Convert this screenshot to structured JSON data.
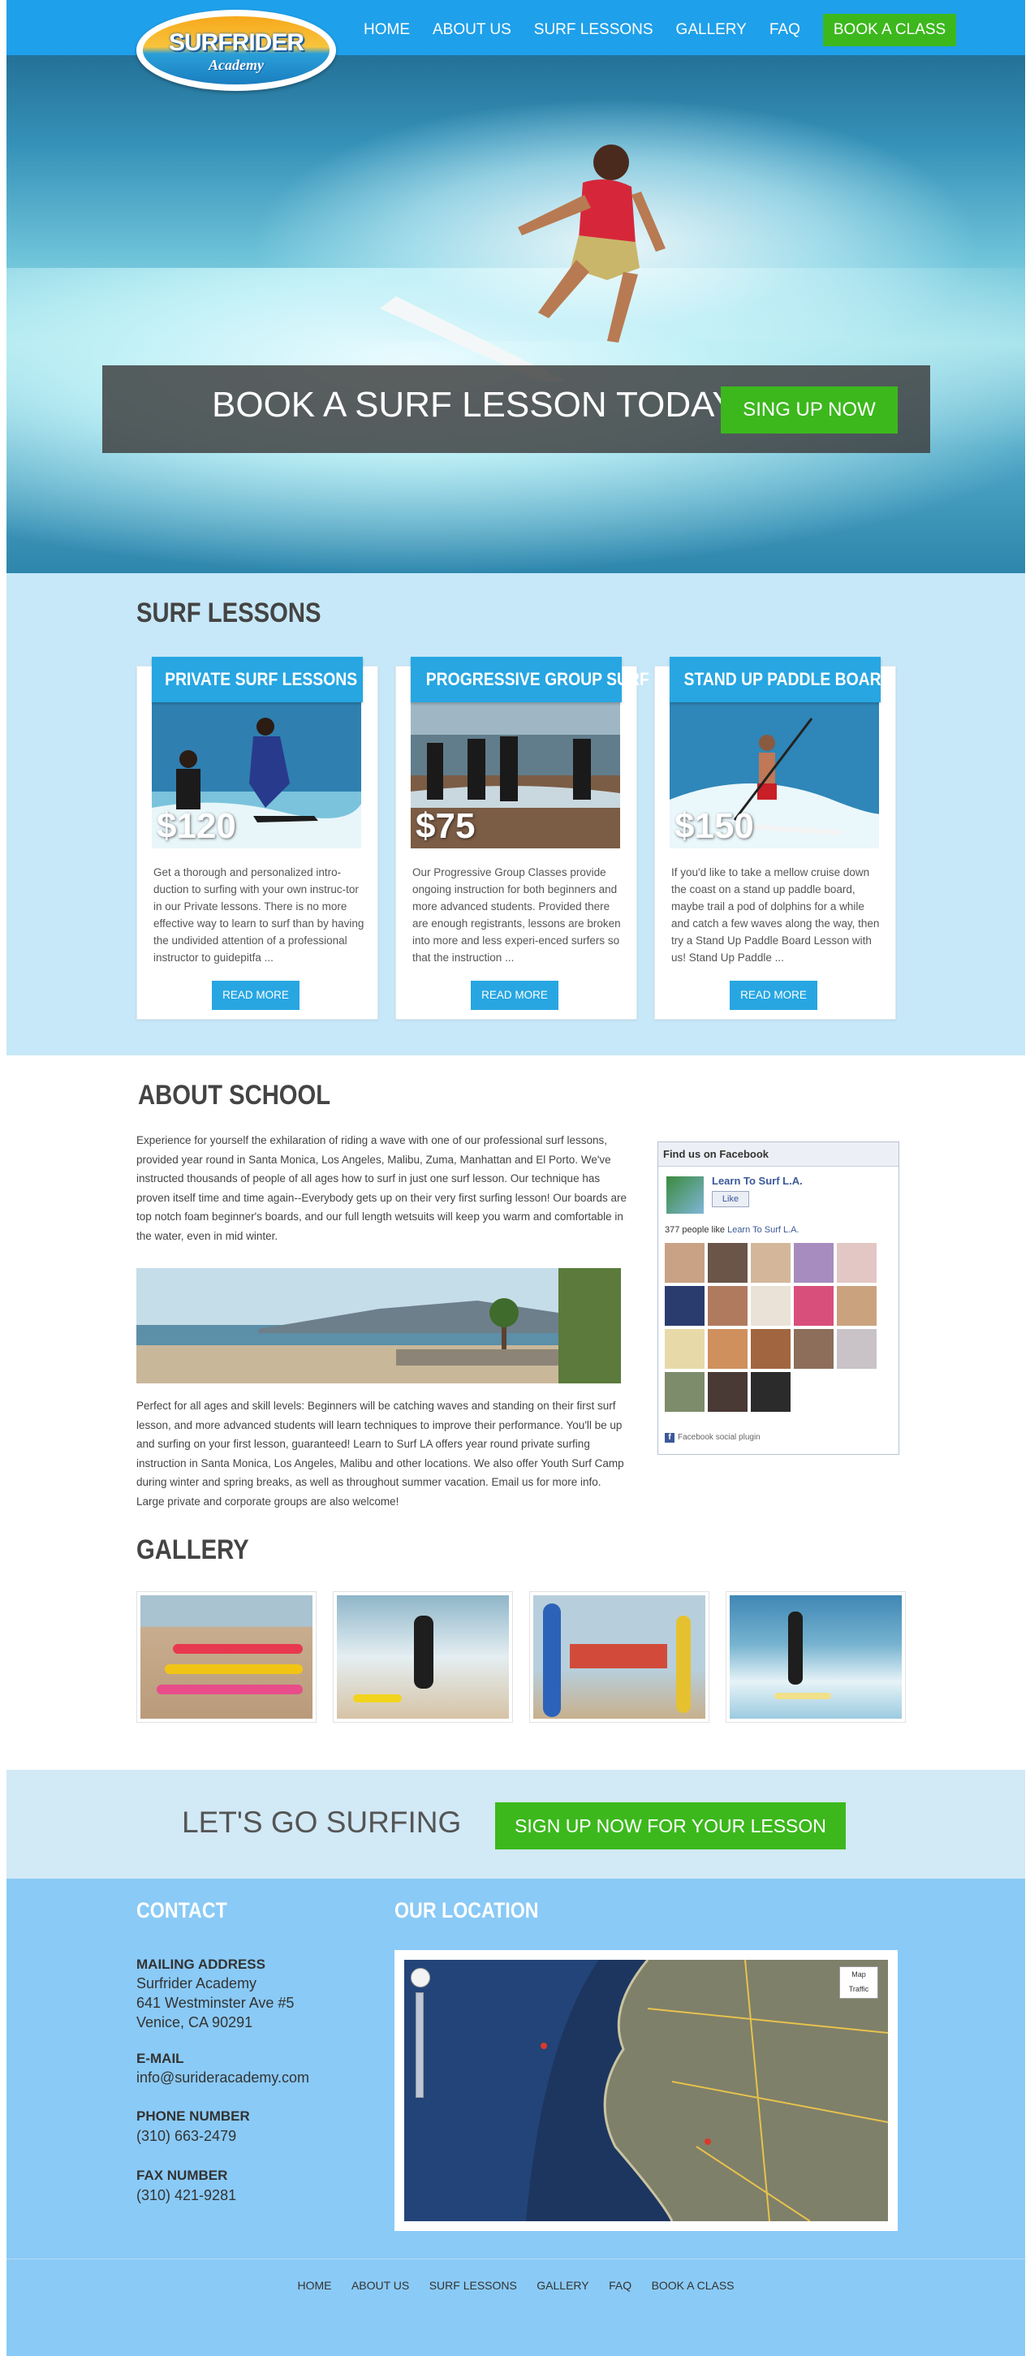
{
  "nav": {
    "logo_title": "SURFRIDER",
    "logo_subtitle": "Academy",
    "items": [
      "HOME",
      "ABOUT US",
      "SURF LESSONS",
      "GALLERY",
      "FAQ"
    ],
    "cta": "BOOK A CLASS"
  },
  "hero": {
    "headline": "BOOK A SURF LESSON TODAY",
    "button": "SING UP NOW"
  },
  "lessons": {
    "heading": "SURF LESSONS",
    "cards": [
      {
        "title": "PRIVATE SURF LESSONS",
        "price": "$120",
        "description": "Get a thorough and personalized intro-duction to surfing with your own instruc-tor in our Private lessons. There is no more effective way to learn to surf than by having the undivided attention of a professional instructor to guidepitfa ...",
        "button": "READ MORE"
      },
      {
        "title": "PROGRESSIVE GROUP SURF",
        "price": "$75",
        "description": "Our Progressive Group Classes provide ongoing instruction for both beginners and more advanced students. Provided there are enough registrants, lessons are broken into more and less experi-enced surfers so that the instruction ...",
        "button": "READ MORE"
      },
      {
        "title": "STAND UP PADDLE BOARD",
        "price": "$150",
        "description": "If you'd like to take a mellow cruise down the coast on a stand up paddle board, maybe trail a pod of dolphins for a while and catch a few waves along the way, then try a Stand Up Paddle Board Lesson with us! Stand Up Paddle ...",
        "button": "READ MORE"
      }
    ]
  },
  "about": {
    "heading": "ABOUT SCHOOL",
    "paragraph1": "Experience for yourself the exhilaration of riding a wave with one of our professional surf lessons, provided year round in Santa Monica, Los Angeles, Malibu, Zuma, Manhattan and El Porto. We've instructed thousands of people of all ages how to surf in just one surf lesson. Our technique has proven itself time and time again--Everybody gets up on their very first surfing lesson! Our boards are top notch foam beginner's boards, and our full length wetsuits will keep you warm and comfortable in the water, even in mid winter.",
    "paragraph2": "Perfect for all ages and skill levels: Beginners will be catching waves and standing on their first surf lesson, and more advanced students will learn techniques to improve their performance. You'll be up and surfing on your first lesson, guaranteed! Learn to Surf LA offers year round private surfing instruction in Santa Monica, Los Angeles, Malibu and other locations. We also offer Youth Surf Camp during winter and spring breaks, as well as throughout summer vacation. Email us for more info. Large private and corporate groups are also welcome!"
  },
  "facebook": {
    "header": "Find us on Facebook",
    "page_name": "Learn To Surf L.A.",
    "like_label": "Like",
    "count_text": "377 people like",
    "count_link": "Learn To Surf L.A.",
    "plugin_label": "Facebook social plugin"
  },
  "gallery": {
    "heading": "GALLERY"
  },
  "cta": {
    "text": "LET'S GO SURFING",
    "button": "SIGN UP NOW FOR YOUR LESSON"
  },
  "contact": {
    "heading": "CONTACT",
    "location_heading": "OUR LOCATION",
    "mailing_label": "MAILING ADDRESS",
    "mailing_lines": [
      "Surfrider Academy",
      "641 Westminster Ave #5",
      "Venice, CA 90291"
    ],
    "email_label": "E-MAIL",
    "email": "info@surideracademy.com",
    "phone_label": "PHONE NUMBER",
    "phone": "(310) 663-2479",
    "fax_label": "FAX NUMBER",
    "fax": "(310) 421-9281",
    "map_type_map": "Map",
    "map_type_traffic": "Traffic"
  },
  "footer": {
    "items": [
      "HOME",
      "ABOUT US",
      "SURF LESSONS",
      "GALLERY",
      "FAQ",
      "BOOK A CLASS"
    ]
  }
}
